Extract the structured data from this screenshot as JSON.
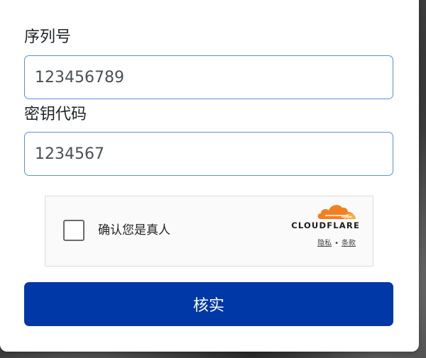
{
  "form": {
    "serial_label": "序列号",
    "serial_value": "123456789",
    "key_label": "密钥代码",
    "key_value": "1234567",
    "submit_label": "核实"
  },
  "captcha": {
    "label": "确认您是真人",
    "brand": "CLOUDFLARE",
    "privacy_link": "隐私",
    "separator": "•",
    "terms_link": "条款",
    "logo_icon": "cloudflare-cloud-icon"
  },
  "colors": {
    "button": "#0038a8",
    "input_border": "#5b8de0",
    "cloudflare_orange": "#f38020"
  }
}
